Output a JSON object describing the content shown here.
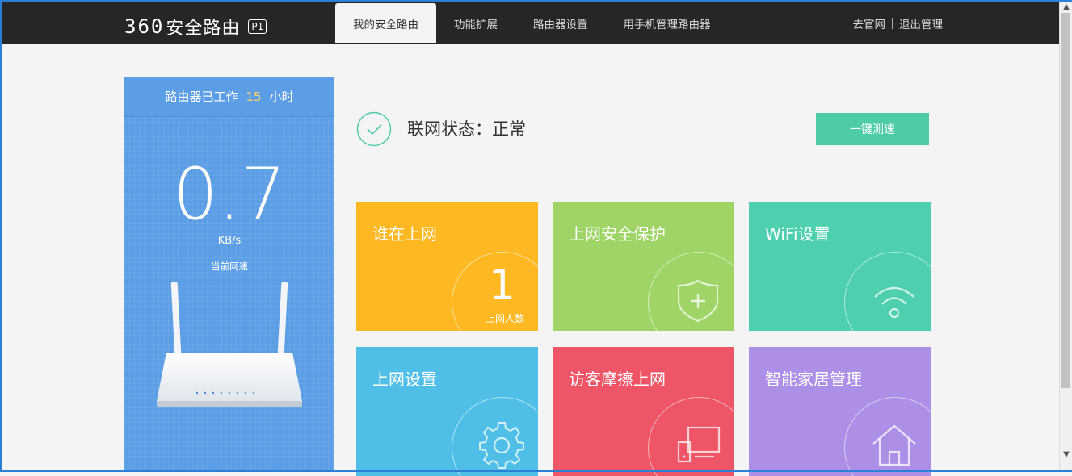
{
  "app": {
    "logo_number": "360",
    "logo_text": "安全路由",
    "logo_badge": "P1"
  },
  "nav": {
    "tabs": [
      {
        "label": "我的安全路由",
        "active": true
      },
      {
        "label": "功能扩展",
        "active": false
      },
      {
        "label": "路由器设置",
        "active": false
      },
      {
        "label": "用手机管理路由器",
        "active": false
      }
    ]
  },
  "top_links": {
    "official_site": "去官网",
    "logout": "退出管理"
  },
  "uptime": {
    "prefix": "路由器已工作",
    "hours": "15",
    "suffix": "小时"
  },
  "speed": {
    "value": "0.7",
    "unit": "KB/s",
    "label": "当前网速"
  },
  "status": {
    "text": "联网状态：正常",
    "speedtest_button": "一键测速"
  },
  "tiles": [
    {
      "title": "谁在上网",
      "color": "#fdb822",
      "icon": "online-count",
      "count": "1",
      "count_label": "上网人数"
    },
    {
      "title": "上网安全保护",
      "color": "#a0d467",
      "icon": "shield-plus-icon"
    },
    {
      "title": "WiFi设置",
      "color": "#4ed0b0",
      "icon": "wifi-icon"
    },
    {
      "title": "上网设置",
      "color": "#4fbfe8",
      "icon": "gear-icon"
    },
    {
      "title": "访客摩擦上网",
      "color": "#ee5566",
      "icon": "devices-icon"
    },
    {
      "title": "智能家居管理",
      "color": "#ad8fe8",
      "icon": "home-icon"
    }
  ],
  "colors": {
    "header_bg": "#262626",
    "accent_green": "#4ecca7",
    "panel_blue": "#5b9ee5",
    "uptime_hours": "#ffd36b"
  }
}
